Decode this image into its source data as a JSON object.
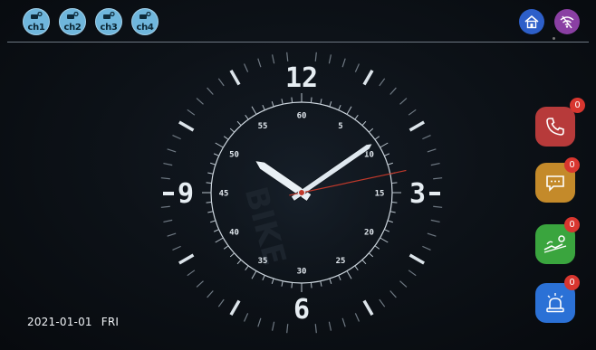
{
  "channels": [
    {
      "label": "ch1",
      "icon": "camera-icon"
    },
    {
      "label": "ch2",
      "icon": "camera-icon"
    },
    {
      "label": "ch3",
      "icon": "camera-icon"
    },
    {
      "label": "ch4",
      "icon": "camera-icon"
    }
  ],
  "top_right": {
    "home_icon": "home-icon",
    "wifi_icon": "wifi-off-icon"
  },
  "clock": {
    "time_shown": "10:09:13",
    "hour_numerals": [
      "12",
      "3",
      "6",
      "9"
    ],
    "minute_labels": [
      "60",
      "5",
      "10",
      "15",
      "20",
      "25",
      "30",
      "35",
      "40",
      "45",
      "50",
      "55"
    ],
    "watermark": "BIKE"
  },
  "side_buttons": [
    {
      "name": "call",
      "icon": "phone-icon",
      "badge": "0",
      "color": "#b73a3a"
    },
    {
      "name": "message",
      "icon": "message-icon",
      "badge": "0",
      "color": "#c48a2a"
    },
    {
      "name": "monitor",
      "icon": "monitor-icon",
      "badge": "0",
      "color": "#3aa53e"
    },
    {
      "name": "alarm",
      "icon": "alarm-icon",
      "badge": "0",
      "color": "#2b71d6"
    }
  ],
  "status": {
    "date": "2021-01-01",
    "weekday": "FRI"
  }
}
